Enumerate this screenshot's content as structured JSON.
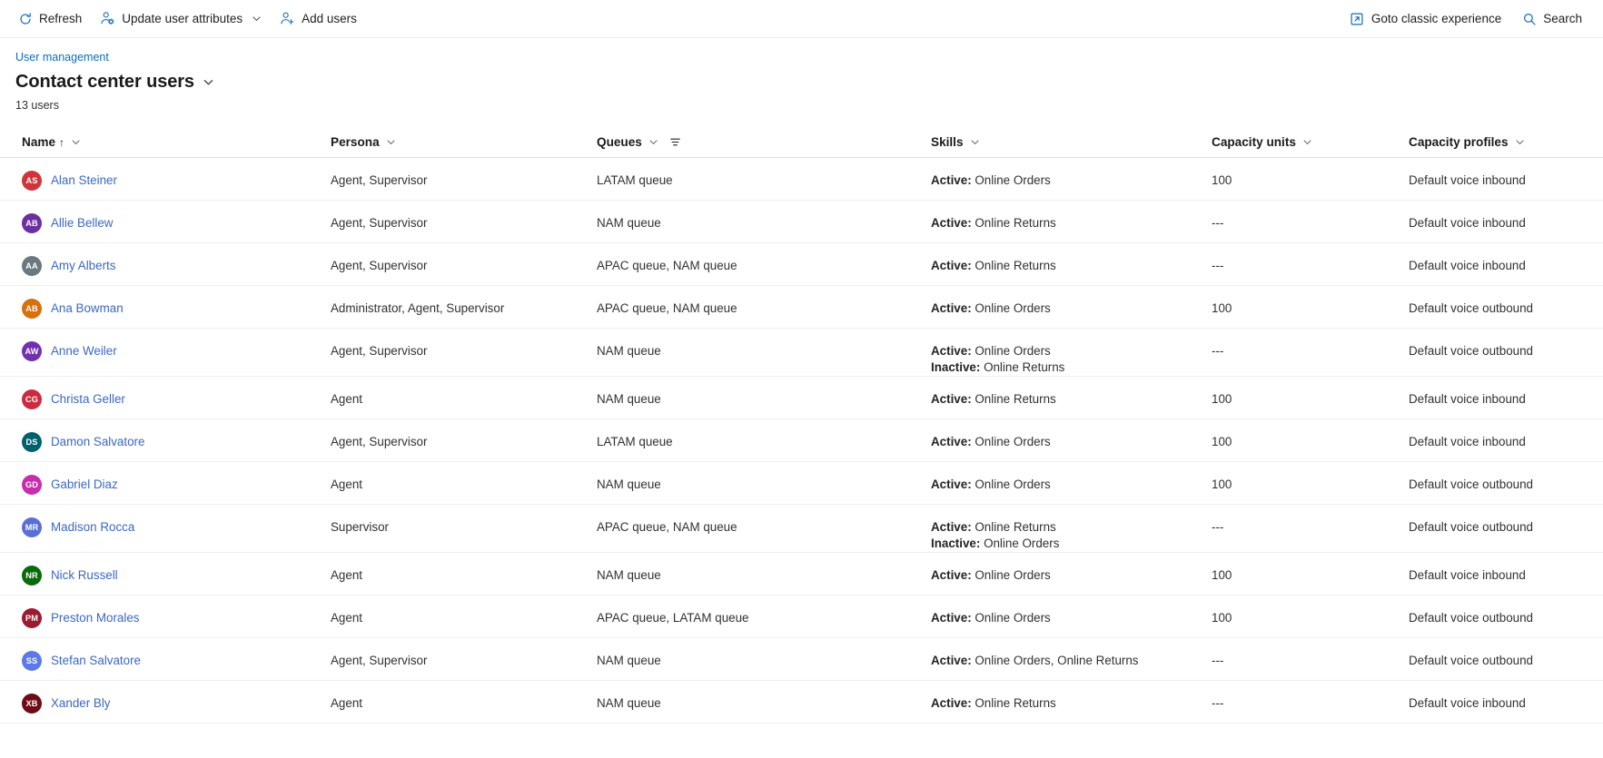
{
  "commandbar": {
    "refresh_label": "Refresh",
    "update_attrs_label": "Update user attributes",
    "add_users_label": "Add users",
    "goto_classic_label": "Goto classic experience",
    "search_label": "Search"
  },
  "header": {
    "breadcrumb": "User management",
    "title": "Contact center users",
    "count": "13 users"
  },
  "grid": {
    "columns": [
      {
        "label": "Name",
        "sorted": true,
        "sort_arrow": "↑",
        "filtered": false
      },
      {
        "label": "Persona",
        "sorted": false,
        "sort_arrow": "",
        "filtered": false
      },
      {
        "label": "Queues",
        "sorted": false,
        "sort_arrow": "",
        "filtered": true
      },
      {
        "label": "Skills",
        "sorted": false,
        "sort_arrow": "",
        "filtered": false
      },
      {
        "label": "Capacity units",
        "sorted": false,
        "sort_arrow": "",
        "filtered": false
      },
      {
        "label": "Capacity profiles",
        "sorted": false,
        "sort_arrow": "",
        "filtered": false
      }
    ],
    "rows": [
      {
        "initials": "AS",
        "avatar_color": "#d13438",
        "name": "Alan Steiner",
        "persona": "Agent, Supervisor",
        "queues": "LATAM queue",
        "skills": [
          {
            "state": "Active:",
            "value": "Online Orders"
          }
        ],
        "capacity_units": "100",
        "capacity_profiles": "Default voice inbound"
      },
      {
        "initials": "AB",
        "avatar_color": "#6b2fa0",
        "name": "Allie Bellew",
        "persona": "Agent, Supervisor",
        "queues": "NAM queue",
        "skills": [
          {
            "state": "Active:",
            "value": "Online Returns"
          }
        ],
        "capacity_units": "---",
        "capacity_profiles": "Default voice inbound"
      },
      {
        "initials": "AA",
        "avatar_color": "#69797e",
        "name": "Amy Alberts",
        "persona": "Agent, Supervisor",
        "queues": "APAC queue, NAM queue",
        "skills": [
          {
            "state": "Active:",
            "value": "Online Returns"
          }
        ],
        "capacity_units": "---",
        "capacity_profiles": "Default voice inbound"
      },
      {
        "initials": "AB",
        "avatar_color": "#d8700c",
        "name": "Ana Bowman",
        "persona": "Administrator, Agent, Supervisor",
        "queues": "APAC queue, NAM queue",
        "skills": [
          {
            "state": "Active:",
            "value": "Online Orders"
          }
        ],
        "capacity_units": "100",
        "capacity_profiles": "Default voice outbound"
      },
      {
        "initials": "AW",
        "avatar_color": "#7330ad",
        "name": "Anne Weiler",
        "persona": "Agent, Supervisor",
        "queues": "NAM queue",
        "skills": [
          {
            "state": "Active:",
            "value": "Online Orders"
          },
          {
            "state": "Inactive:",
            "value": "Online Returns"
          }
        ],
        "capacity_units": "---",
        "capacity_profiles": "Default voice outbound"
      },
      {
        "initials": "CG",
        "avatar_color": "#cc2b3f",
        "name": "Christa Geller",
        "persona": "Agent",
        "queues": "NAM queue",
        "skills": [
          {
            "state": "Active:",
            "value": "Online Returns"
          }
        ],
        "capacity_units": "100",
        "capacity_profiles": "Default voice inbound"
      },
      {
        "initials": "DS",
        "avatar_color": "#00616e",
        "name": "Damon Salvatore",
        "persona": "Agent, Supervisor",
        "queues": "LATAM queue",
        "skills": [
          {
            "state": "Active:",
            "value": "Online Orders"
          }
        ],
        "capacity_units": "100",
        "capacity_profiles": "Default voice inbound"
      },
      {
        "initials": "GD",
        "avatar_color": "#c72dad",
        "name": "Gabriel Diaz",
        "persona": "Agent",
        "queues": "NAM queue",
        "skills": [
          {
            "state": "Active:",
            "value": "Online Orders"
          }
        ],
        "capacity_units": "100",
        "capacity_profiles": "Default voice outbound"
      },
      {
        "initials": "MR",
        "avatar_color": "#5a6fd6",
        "name": "Madison Rocca",
        "persona": "Supervisor",
        "queues": "APAC queue, NAM queue",
        "skills": [
          {
            "state": "Active:",
            "value": "Online Returns"
          },
          {
            "state": "Inactive:",
            "value": "Online Orders"
          }
        ],
        "capacity_units": "---",
        "capacity_profiles": "Default voice outbound"
      },
      {
        "initials": "NR",
        "avatar_color": "#0b6a0b",
        "name": "Nick Russell",
        "persona": "Agent",
        "queues": "NAM queue",
        "skills": [
          {
            "state": "Active:",
            "value": "Online Orders"
          }
        ],
        "capacity_units": "100",
        "capacity_profiles": "Default voice inbound"
      },
      {
        "initials": "PM",
        "avatar_color": "#9b1b30",
        "name": "Preston Morales",
        "persona": "Agent",
        "queues": "APAC queue, LATAM queue",
        "skills": [
          {
            "state": "Active:",
            "value": "Online Orders"
          }
        ],
        "capacity_units": "100",
        "capacity_profiles": "Default voice outbound"
      },
      {
        "initials": "SS",
        "avatar_color": "#5b7ae8",
        "name": "Stefan Salvatore",
        "persona": "Agent, Supervisor",
        "queues": "NAM queue",
        "skills": [
          {
            "state": "Active:",
            "value": "Online Orders, Online Returns"
          }
        ],
        "capacity_units": "---",
        "capacity_profiles": "Default voice outbound"
      },
      {
        "initials": "XB",
        "avatar_color": "#6e0b14",
        "name": "Xander Bly",
        "persona": "Agent",
        "queues": "NAM queue",
        "skills": [
          {
            "state": "Active:",
            "value": "Online Returns"
          }
        ],
        "capacity_units": "---",
        "capacity_profiles": "Default voice inbound"
      }
    ]
  }
}
